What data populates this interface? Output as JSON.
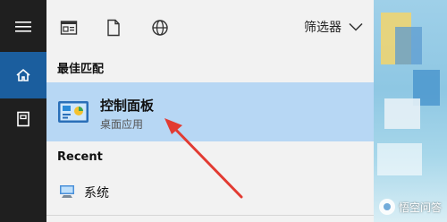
{
  "toolbar": {
    "icons": [
      "document-window-icon",
      "document-icon",
      "globe-icon"
    ],
    "filter_label": "筛选器"
  },
  "best_match": {
    "heading": "最佳匹配",
    "title": "控制面板",
    "subtitle": "桌面应用"
  },
  "recent": {
    "heading": "Recent",
    "items": [
      {
        "label": "系统",
        "icon": "system-monitor-icon"
      }
    ]
  },
  "watermark": {
    "text": "悟空问答"
  },
  "colors": {
    "rail": "#1f1f1f",
    "rail_active": "#1b5e9e",
    "panel": "#f2f2f2",
    "selected": "#b7d7f4",
    "annotation": "#e23b32"
  }
}
